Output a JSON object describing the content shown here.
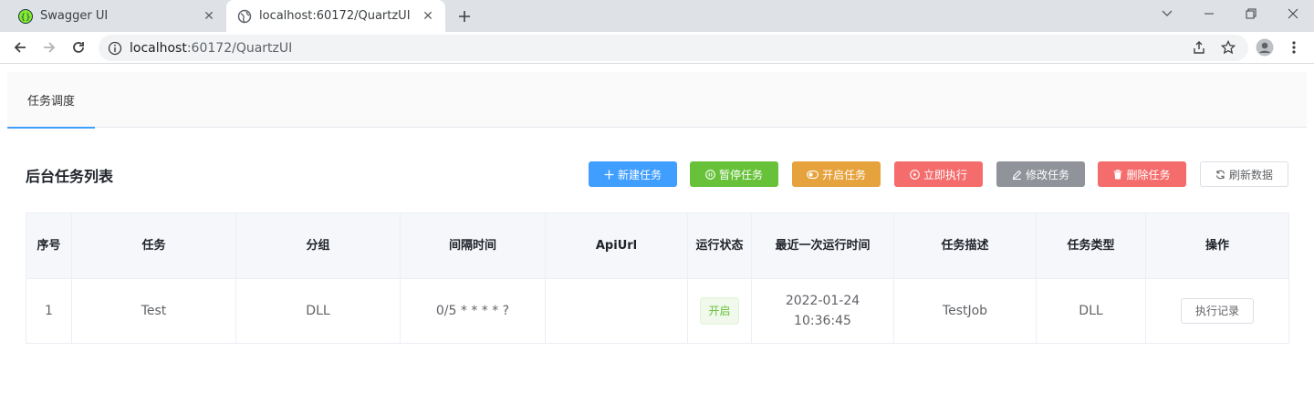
{
  "browser": {
    "tabs": [
      {
        "title": "Swagger UI",
        "icon": "swagger-icon",
        "active": false
      },
      {
        "title": "localhost:60172/QuartzUI",
        "icon": "globe-icon",
        "active": true
      }
    ],
    "url_host": "localhost",
    "url_rest": ":60172/QuartzUI"
  },
  "app": {
    "tab_label": "任务调度",
    "list_title": "后台任务列表",
    "toolbar": {
      "new_label": "新建任务",
      "pause_label": "暂停任务",
      "start_label": "开启任务",
      "run_label": "立即执行",
      "edit_label": "修改任务",
      "delete_label": "删除任务",
      "refresh_label": "刷新数据"
    },
    "colors": {
      "primary": "#409eff",
      "success": "#67c23a",
      "warning": "#e6a23c",
      "danger": "#f56c6c",
      "info": "#909399"
    }
  },
  "table": {
    "headers": [
      "序号",
      "任务",
      "分组",
      "间隔时间",
      "ApiUrl",
      "运行状态",
      "最近一次运行时间",
      "任务描述",
      "任务类型",
      "操作"
    ],
    "rows": [
      {
        "index": "1",
        "task": "Test",
        "group": "DLL",
        "interval": "0/5 * * * * ?",
        "api_url": "",
        "status": "开启",
        "last_run": "2022-01-24 10:36:45",
        "description": "TestJob",
        "type": "DLL",
        "action": "执行记录"
      }
    ]
  }
}
